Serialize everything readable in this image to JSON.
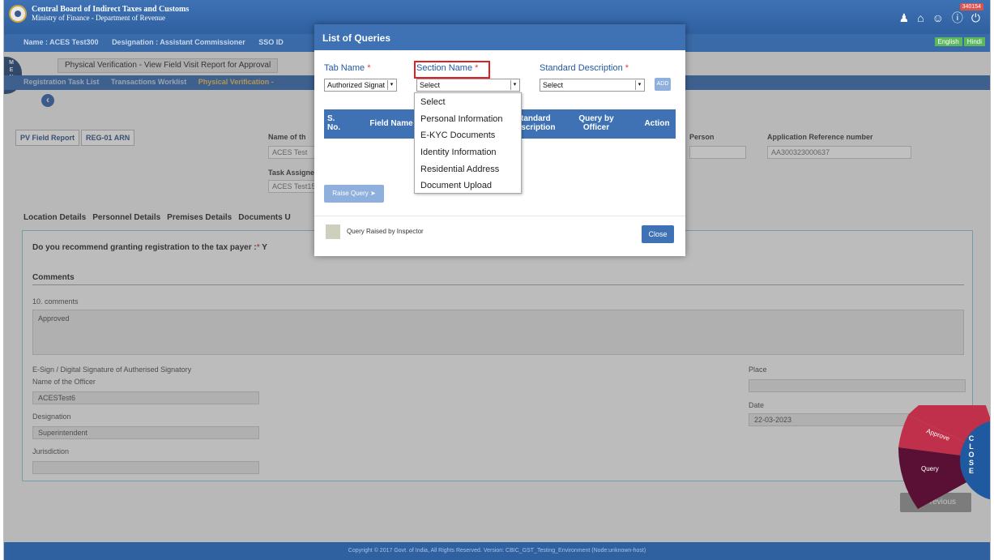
{
  "header": {
    "org_name": "Central Board of Indirect Taxes and Customs",
    "org_sub": "Ministry of Finance - Department of Revenue",
    "badge": "340154"
  },
  "userbar": {
    "name": "Name : ACES Test300",
    "designation": "Designation : Assistant Commissioner",
    "sso": "SSO ID",
    "lang_english": "English",
    "lang_hindi": "Hindi"
  },
  "menu_tab": "MENU",
  "page_title": "Physical Verification - View Field Visit Report for Approval",
  "breadcrumbs": [
    "Registration Task List",
    "Transactions Worklist",
    "Physical Verification -"
  ],
  "tabs": [
    "PV Field Report",
    "REG-01 ARN"
  ],
  "fields": {
    "name_label": "Name of th",
    "name_value": "ACES Test",
    "task_assigned_label": "Task Assigne",
    "task_assigned_value": "ACES Test15",
    "person_label": "Person",
    "app_ref_label": "Application Reference number",
    "app_ref_value": "AA300323000637"
  },
  "subtabs": [
    "Location Details",
    "Personnel Details",
    "Premises Details",
    "Documents U"
  ],
  "form": {
    "question": "Do you recommend granting registration to the tax payer :",
    "question_suffix": "Y",
    "comments_heading": "Comments",
    "comments_label": "10. comments",
    "comments_value": "Approved",
    "esign_label": "E-Sign / Digital Signature of Autherised Signatory",
    "officer_label": "Name of the Officer",
    "officer_value": "ACESTest6",
    "designation_label": "Designation",
    "designation_value": "Superintendent",
    "jurisdiction_label": "Jurisdiction",
    "place_label": "Place",
    "date_label": "Date",
    "date_value": "22-03-2023"
  },
  "previous_label": "Previous",
  "footer": "Copyright © 2017 Govt. of India, All Rights Reserved. Version: CBIC_GST_Testing_Environment   (Node:unknown-host)",
  "wheel": {
    "approve": "Approve",
    "query": "Query",
    "close": "CLOSE"
  },
  "modal": {
    "title": "List of Queries",
    "tab_name_label": "Tab Name",
    "tab_name_value": "Authorized Signat",
    "section_name_label": "Section Name",
    "section_name_value": "Select",
    "std_desc_label": "Standard Description",
    "std_desc_value": "Select",
    "add_label": "ADD",
    "columns": {
      "sno": "S. No.",
      "field": "Field Name",
      "std": "Standard Description",
      "query": "Query by Officer",
      "action": "Action"
    },
    "raise_query": "Raise Query",
    "legend": "Query Raised by Inspector",
    "close_label": "Close"
  },
  "dropdown_options": [
    "Select",
    "Personal Information",
    "E-KYC Documents",
    "Identity Information",
    "Residential Address",
    "Document Upload"
  ]
}
